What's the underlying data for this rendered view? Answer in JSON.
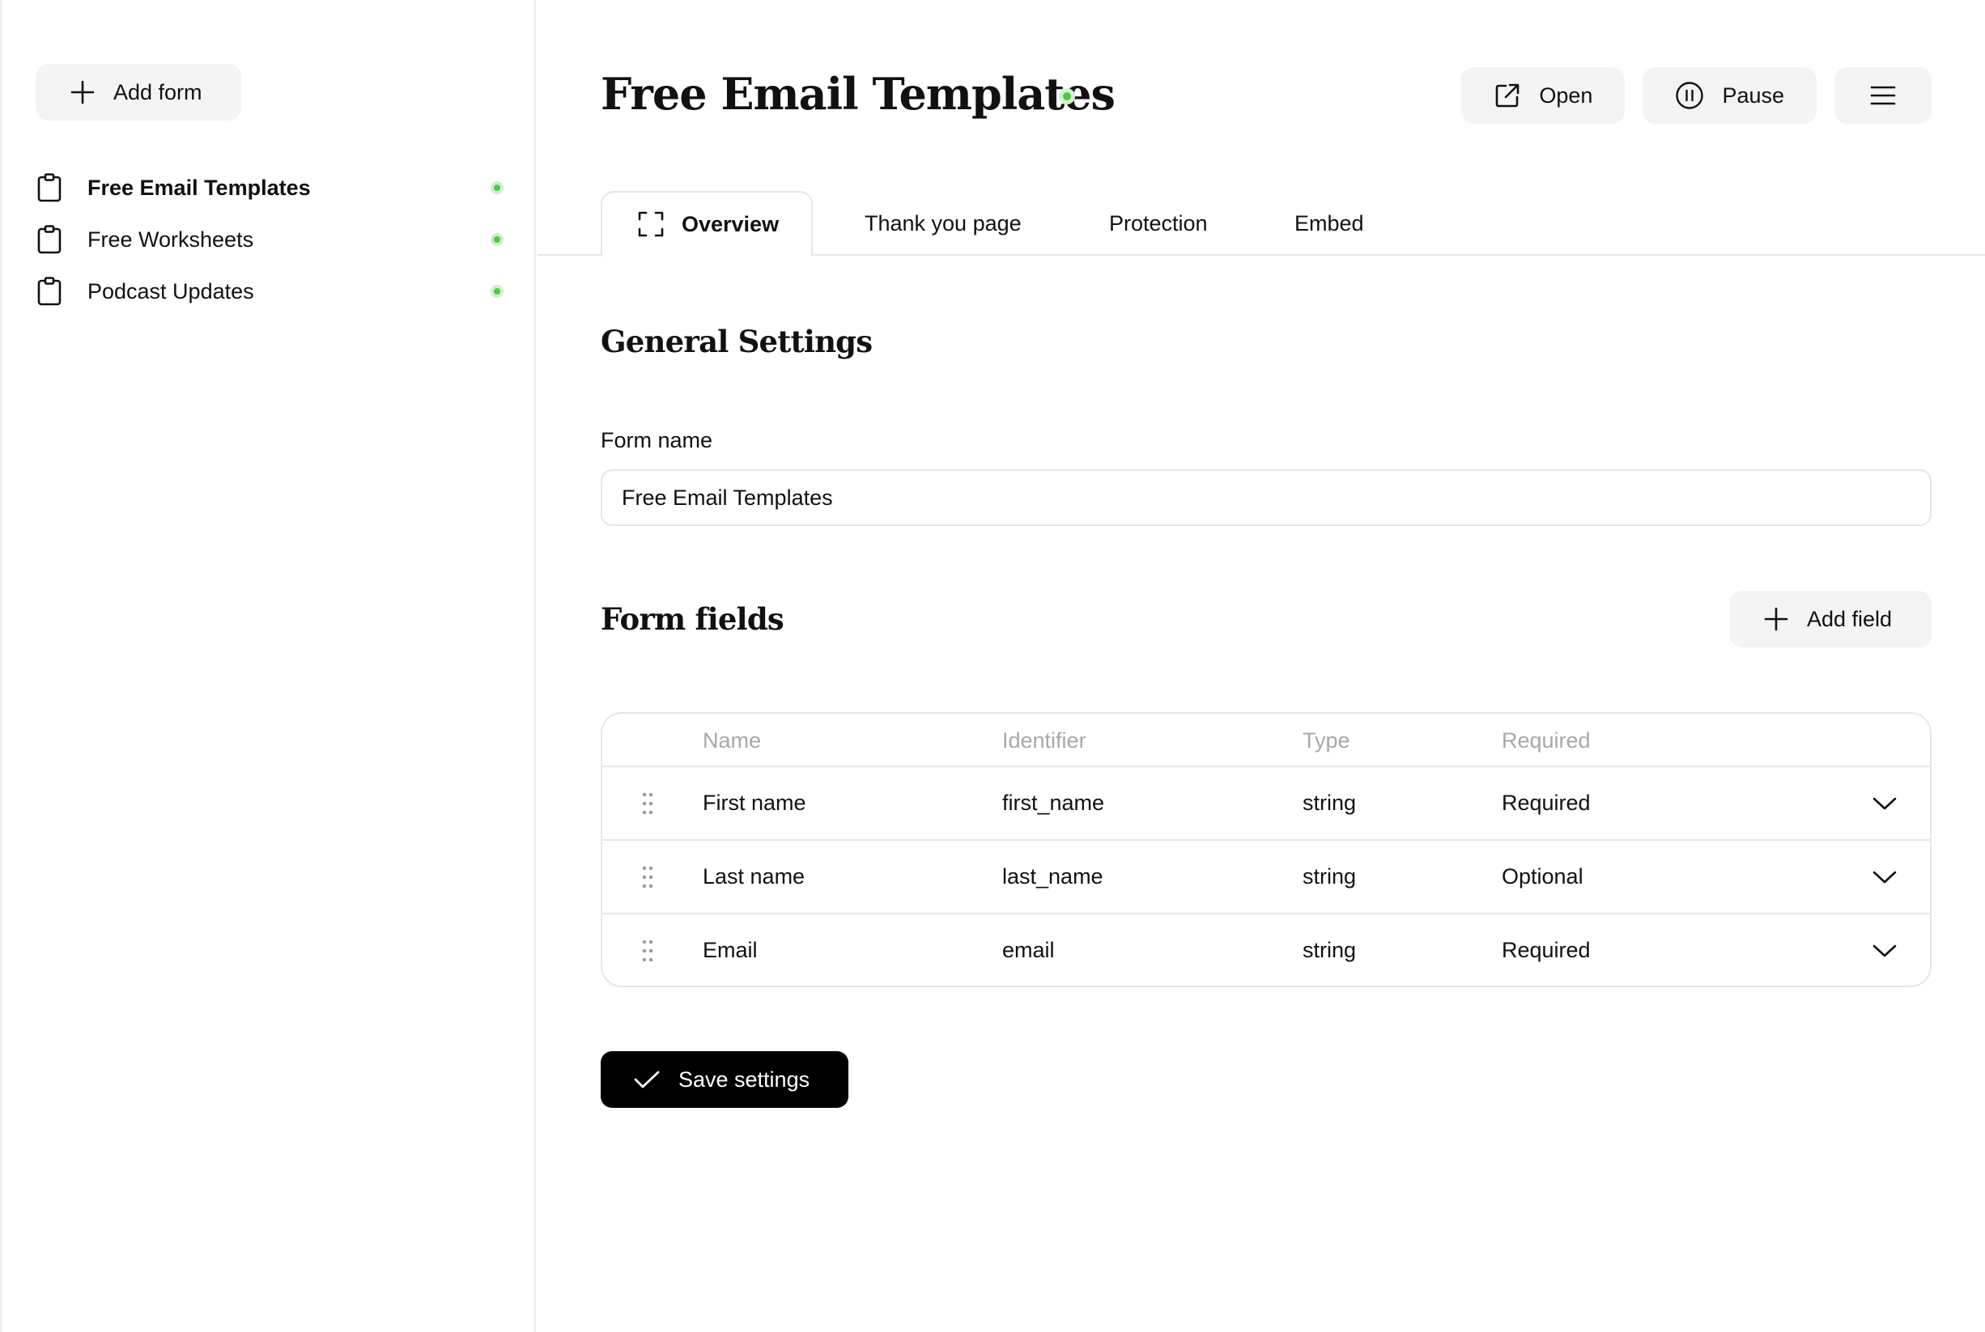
{
  "sidebar": {
    "add_form_label": "Add form",
    "forms": [
      {
        "label": "Free Email Templates",
        "active": true,
        "status_color": "#4cc94a"
      },
      {
        "label": "Free Worksheets",
        "active": false,
        "status_color": "#4cc94a"
      },
      {
        "label": "Podcast Updates",
        "active": false,
        "status_color": "#4cc94a"
      }
    ]
  },
  "header": {
    "title": "Free Email Templates",
    "status_color": "#4cc94a",
    "open_label": "Open",
    "pause_label": "Pause"
  },
  "tabs": [
    {
      "label": "Overview",
      "active": true
    },
    {
      "label": "Thank you page",
      "active": false
    },
    {
      "label": "Protection",
      "active": false
    },
    {
      "label": "Embed",
      "active": false
    }
  ],
  "general": {
    "title": "General Settings",
    "form_name_label": "Form name",
    "form_name_value": "Free Email Templates"
  },
  "fields": {
    "title": "Form fields",
    "add_field_label": "Add field",
    "columns": [
      "Name",
      "Identifier",
      "Type",
      "Required"
    ],
    "rows": [
      {
        "name": "First name",
        "identifier": "first_name",
        "type": "string",
        "required": "Required"
      },
      {
        "name": "Last name",
        "identifier": "last_name",
        "type": "string",
        "required": "Optional"
      },
      {
        "name": "Email",
        "identifier": "email",
        "type": "string",
        "required": "Required"
      }
    ]
  },
  "save_label": "Save settings",
  "colors": {
    "accent": "#000000",
    "status": "#4cc94a",
    "border": "#e6e6e6"
  }
}
